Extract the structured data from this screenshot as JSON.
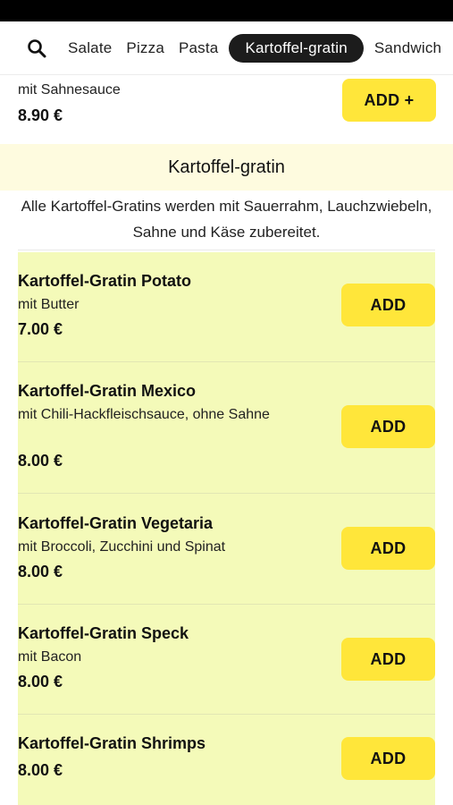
{
  "nav": {
    "tabs": [
      {
        "label": "Salate",
        "active": false
      },
      {
        "label": "Pizza",
        "active": false
      },
      {
        "label": "Pasta",
        "active": false
      },
      {
        "label": "Kartoffel-gratin",
        "active": true
      },
      {
        "label": "Sandwich",
        "active": false
      }
    ]
  },
  "previous_item": {
    "description": "mit Sahnesauce",
    "price": "8.90 €",
    "button_label": "ADD +"
  },
  "section": {
    "title": "Kartoffel-gratin",
    "description": "Alle Kartoffel-Gratins werden mit Sauerrahm, Lauchzwiebeln, Sahne und Käse zubereitet."
  },
  "items": [
    {
      "name": "Kartoffel-Gratin Potato",
      "description": "mit Butter",
      "price": "7.00 €",
      "button_label": "ADD"
    },
    {
      "name": "Kartoffel-Gratin Mexico",
      "description": "mit Chili-Hackfleischsauce, ohne Sahne",
      "price": "8.00 €",
      "button_label": "ADD"
    },
    {
      "name": "Kartoffel-Gratin Vegetaria",
      "description": "mit Broccoli, Zucchini und Spinat",
      "price": "8.00 €",
      "button_label": "ADD"
    },
    {
      "name": "Kartoffel-Gratin Speck",
      "description": "mit Bacon",
      "price": "8.00 €",
      "button_label": "ADD"
    },
    {
      "name": "Kartoffel-Gratin Shrimps",
      "description": "",
      "price": "8.00 €",
      "button_label": "ADD"
    }
  ],
  "colors": {
    "accent_button": "#ffe63a",
    "active_tab": "#1c1c1c",
    "section_header_bg": "#fefbdf",
    "items_bg": "#f4fab9"
  }
}
